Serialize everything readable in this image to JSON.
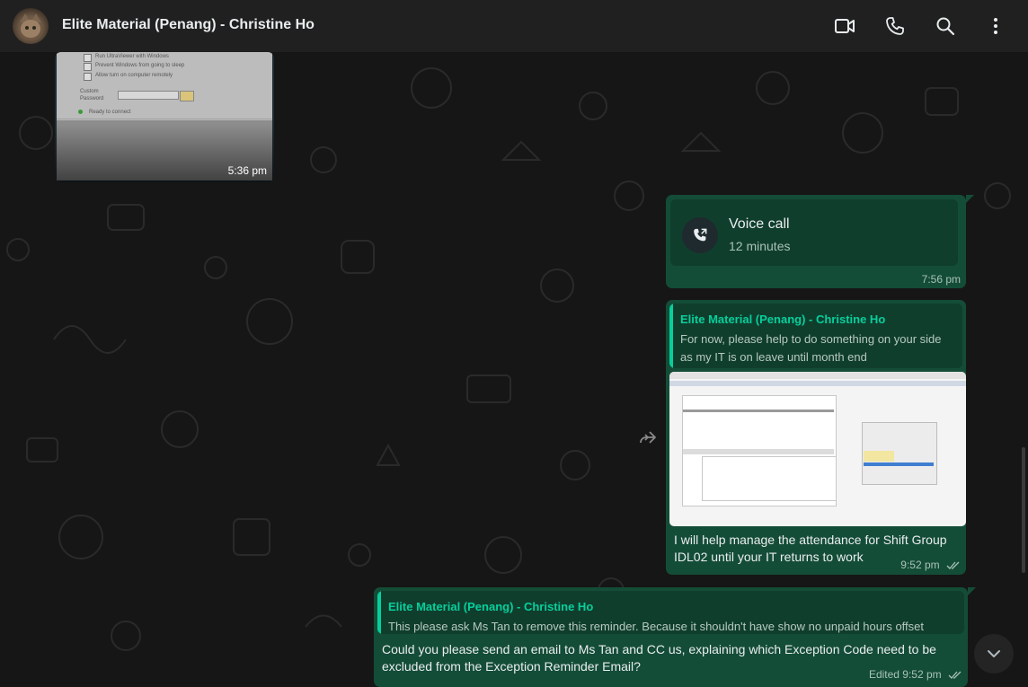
{
  "header": {
    "chat_name": "Elite Material (Penang) - Christine Ho",
    "icons": [
      "video-call-icon",
      "voice-call-icon",
      "search-icon",
      "menu-icon"
    ]
  },
  "messages": {
    "image_in": {
      "time": "5:36 pm",
      "screenshot_lines": [
        "Run UltraViewer with Windows",
        "Prevent Windows from going to sleep",
        "Allow turn on computer remotely",
        "Custom",
        "Password",
        "Ready to connect"
      ]
    },
    "voice_call": {
      "title": "Voice call",
      "duration": "12 minutes",
      "time": "7:56 pm"
    },
    "reply_1": {
      "quoted_name": "Elite Material (Penang) - Christine Ho",
      "quoted_line1": "For now, please help to do something on your side",
      "quoted_line2": "as my IT is on leave until month end",
      "text_line1": "I will help manage the attendance for Shift Group",
      "text_line2": "IDL02 until your IT returns to work",
      "time": "9:52 pm"
    },
    "reply_2": {
      "quoted_name": "Elite Material (Penang) - Christine Ho",
      "quoted_text": "This please ask Ms Tan to remove this reminder. Because it shouldn't have show no unpaid hours offset",
      "text_line1": "Could you please send an email to Ms Tan and CC us, explaining which Exception Code need to be",
      "text_line2": "excluded from the Exception Reminder Email?",
      "time": "Edited 9:52 pm"
    }
  },
  "colors": {
    "header_bg": "#202020",
    "outgoing_bubble": "#144d37",
    "quote_accent": "#06cf9c",
    "chat_bg": "#161616"
  }
}
